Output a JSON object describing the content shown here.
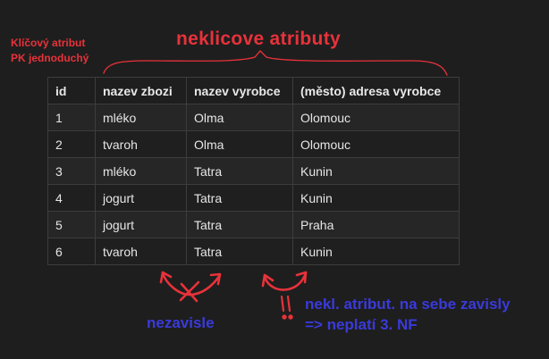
{
  "annotations": {
    "pk_note_line1": "Klíčový atribut",
    "pk_note_line2": "PK jednoduchý",
    "nonkey_title": "neklicove atributy",
    "independent_label": "nezavisle",
    "dependent_line1": "nekl. atribut. na sebe zavisly",
    "dependent_line2": "=> neplatí 3. NF",
    "exclamation": "!!",
    "colors": {
      "red": "#e8323a",
      "blue": "#3a3adb"
    }
  },
  "table": {
    "headers": [
      "id",
      "nazev zbozi",
      "nazev vyrobce",
      "(město) adresa vyrobce"
    ],
    "rows": [
      [
        "1",
        "mléko",
        "Olma",
        "Olomouc"
      ],
      [
        "2",
        "tvaroh",
        "Olma",
        "Olomouc"
      ],
      [
        "3",
        "mléko",
        "Tatra",
        "Kunin"
      ],
      [
        "4",
        "jogurt",
        "Tatra",
        "Kunin"
      ],
      [
        "5",
        "jogurt",
        "Tatra",
        "Praha"
      ],
      [
        "6",
        "tvaroh",
        "Tatra",
        "Kunin"
      ]
    ]
  }
}
